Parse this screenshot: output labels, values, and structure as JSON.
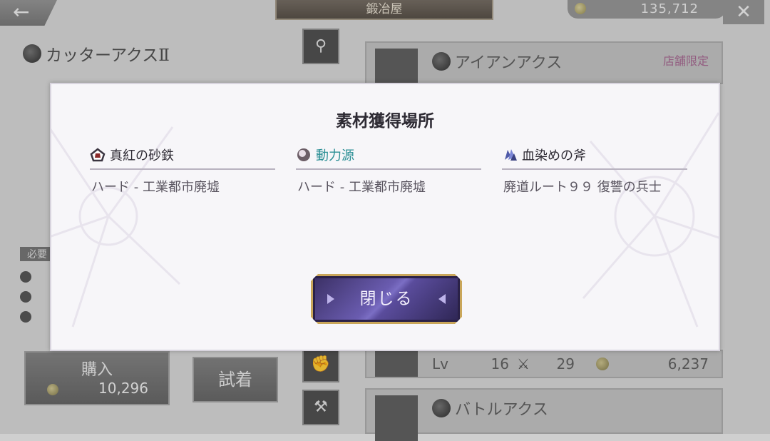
{
  "header": {
    "back_icon": "arrow-left-icon",
    "title": "鍛冶屋",
    "money": "135,712",
    "close_icon": "close-x-icon"
  },
  "left_panel": {
    "weapon_name": "カッターアクスⅡ",
    "required_label": "必要",
    "buy_label": "購入",
    "buy_price": "10,296",
    "try_label": "試着"
  },
  "list": {
    "items": [
      {
        "name": "アイアンアクス",
        "tag": "店舗限定"
      },
      {
        "lv_label": "Lv",
        "lv": "16",
        "atk": "29",
        "price": "6,237"
      },
      {
        "name": "バトルアクス"
      }
    ]
  },
  "modal": {
    "title": "素材獲得場所",
    "materials": [
      {
        "name": "真紅の砂鉄",
        "location": "ハード - 工業都市廃墟",
        "icon": "crimson-ore-icon",
        "highlight": false
      },
      {
        "name": "動力源",
        "location": "ハード - 工業都市廃墟",
        "icon": "power-orb-icon",
        "highlight": true
      },
      {
        "name": "血染めの斧",
        "location": "廃道ルート９９ 復讐の兵士",
        "icon": "crystal-icon",
        "highlight": false
      }
    ],
    "close_label": "閉じる"
  },
  "colors": {
    "highlight_text": "#2b8f95",
    "button_gold": "#c9a65a",
    "button_purple": "#6a5cb0"
  }
}
